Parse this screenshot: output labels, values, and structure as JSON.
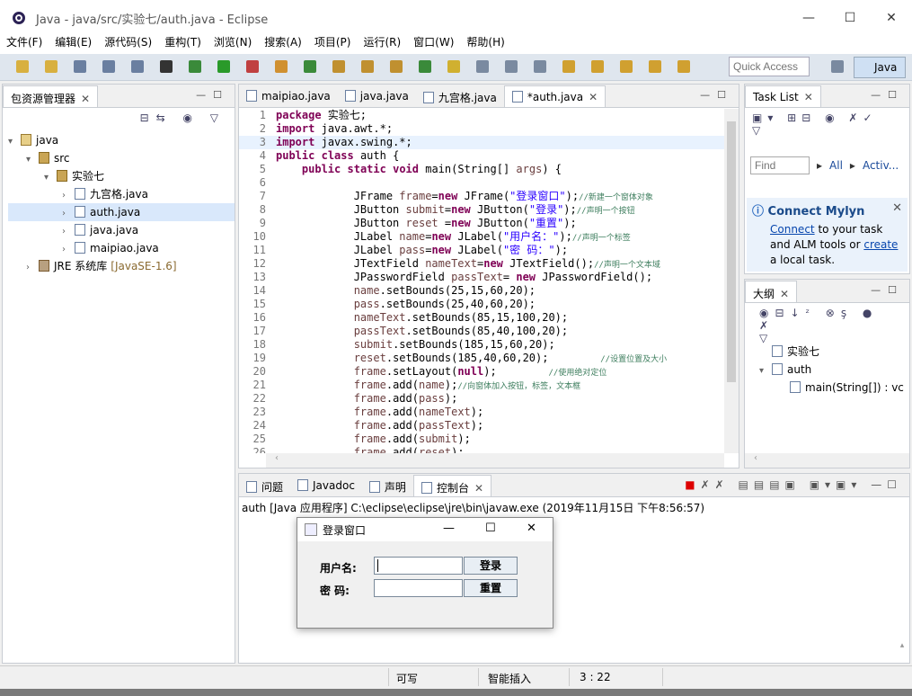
{
  "window": {
    "title": "Java  - java/src/实验七/auth.java  - Eclipse",
    "minimize": "—",
    "maximize": "☐",
    "close": "✕"
  },
  "menu": [
    "文件(F)",
    "编辑(E)",
    "源代码(S)",
    "重构(T)",
    "浏览(N)",
    "搜索(A)",
    "项目(P)",
    "运行(R)",
    "窗口(W)",
    "帮助(H)"
  ],
  "toolbar": {
    "quick_access_placeholder": "Quick Access",
    "perspective": "Java"
  },
  "package_explorer": {
    "title": "包资源管理器",
    "tree": [
      {
        "label": "java",
        "indent": 0,
        "arrow": "▾",
        "icon": "prj"
      },
      {
        "label": "src",
        "indent": 1,
        "arrow": "▾",
        "icon": "pkg"
      },
      {
        "label": "实验七",
        "indent": 2,
        "arrow": "▾",
        "icon": "pkg"
      },
      {
        "label": "九宫格.java",
        "indent": 3,
        "arrow": "›",
        "icon": "file"
      },
      {
        "label": "auth.java",
        "indent": 3,
        "arrow": "›",
        "icon": "file",
        "selected": true
      },
      {
        "label": "java.java",
        "indent": 3,
        "arrow": "›",
        "icon": "file"
      },
      {
        "label": "maipiao.java",
        "indent": 3,
        "arrow": "›",
        "icon": "file"
      },
      {
        "label": "JRE 系统库",
        "extra": "[JavaSE-1.6]",
        "indent": 1,
        "arrow": "›",
        "icon": "lib"
      }
    ]
  },
  "editor": {
    "tabs": [
      {
        "label": "maipiao.java"
      },
      {
        "label": "java.java"
      },
      {
        "label": "九宫格.java"
      },
      {
        "label": "*auth.java",
        "active": true
      }
    ],
    "current_line": 3,
    "lines": [
      "package 实验七;",
      "import java.awt.*;",
      "import javax.swing.*;",
      "public class auth {",
      "    public static void main(String[] args) {",
      "",
      "            JFrame frame=new JFrame(\"登录窗口\");//新建一个窗体对象",
      "            JButton submit=new JButton(\"登录\");//声明一个按钮",
      "            JButton reset =new JButton(\"重置\");",
      "            JLabel name=new JLabel(\"用户名：\");//声明一个标签",
      "            JLabel pass=new JLabel(\"密 码：\");",
      "            JTextField nameText=new JTextField();//声明一个文本域",
      "            JPasswordField passText= new JPasswordField();",
      "            name.setBounds(25,15,60,20);",
      "            pass.setBounds(25,40,60,20);",
      "            nameText.setBounds(85,15,100,20);",
      "            passText.setBounds(85,40,100,20);",
      "            submit.setBounds(185,15,60,20);",
      "            reset.setBounds(185,40,60,20);        //设置位置及大小",
      "            frame.setLayout(null);        //使用绝对定位",
      "            frame.add(name);//向窗体加入按钮，标签，文本框",
      "            frame.add(pass);",
      "            frame.add(nameText);",
      "            frame.add(passText);",
      "            frame.add(submit);",
      "            frame.add(reset);"
    ]
  },
  "task_list": {
    "title": "Task List",
    "find_placeholder": "Find",
    "all": "All",
    "activate": "Activ..."
  },
  "mylyn": {
    "title": "Connect Mylyn",
    "connect": "Connect",
    "text1": " to your task and ALM tools or ",
    "create": "create",
    "text2": " a local task."
  },
  "outline": {
    "title": "大纲",
    "items": [
      {
        "label": "实验七",
        "indent": 0
      },
      {
        "label": "auth",
        "indent": 0,
        "arrow": "▾"
      },
      {
        "label": "main(String[]) : vc",
        "indent": 1
      }
    ]
  },
  "console": {
    "tabs": [
      {
        "label": "问题"
      },
      {
        "label": "Javadoc"
      },
      {
        "label": "声明"
      },
      {
        "label": "控制台",
        "active": true
      }
    ],
    "header": "auth [Java 应用程序] C:\\eclipse\\eclipse\\jre\\bin\\javaw.exe  (2019年11月15日 下午8:56:57)"
  },
  "dialog": {
    "title": "登录窗口",
    "name_label": "用户名:",
    "pass_label": "密  码:",
    "login": "登录",
    "reset": "重置",
    "minimize": "—",
    "maximize": "☐",
    "close": "✕"
  },
  "status": {
    "writable": "可写",
    "insert_mode": "智能插入",
    "position": "3 : 22"
  }
}
